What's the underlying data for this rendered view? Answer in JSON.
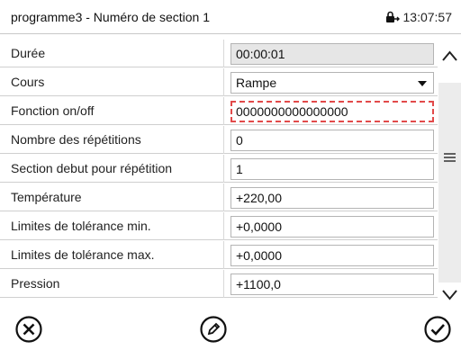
{
  "header": {
    "title": "programme3 - Numéro de section 1",
    "time": "13:07:57",
    "lock_icon": "lock-icon"
  },
  "rows": [
    {
      "label": "Durée",
      "value": "00:00:01",
      "kind": "readonly"
    },
    {
      "label": "Cours",
      "value": "Rampe",
      "kind": "select"
    },
    {
      "label": "Fonction on/off",
      "value": "0000000000000000",
      "kind": "invalid"
    },
    {
      "label": "Nombre des répétitions",
      "value": "0",
      "kind": "input"
    },
    {
      "label": "Section debut pour répétition",
      "value": "1",
      "kind": "input"
    },
    {
      "label": "Température",
      "value": "+220,00",
      "kind": "input"
    },
    {
      "label": "Limites de tolérance min.",
      "value": "+0,0000",
      "kind": "input"
    },
    {
      "label": "Limites de tolérance max.",
      "value": "+0,0000",
      "kind": "input"
    },
    {
      "label": "Pression",
      "value": "+1100,0",
      "kind": "input"
    }
  ],
  "bottombar": {
    "cancel_icon": "close-circle-icon",
    "edit_icon": "pencil-circle-icon",
    "confirm_icon": "check-circle-icon"
  },
  "colors": {
    "invalid_border": "#e24a4a",
    "readonly_bg": "#e6e6e6",
    "scroll_thumb": "#ececec"
  }
}
